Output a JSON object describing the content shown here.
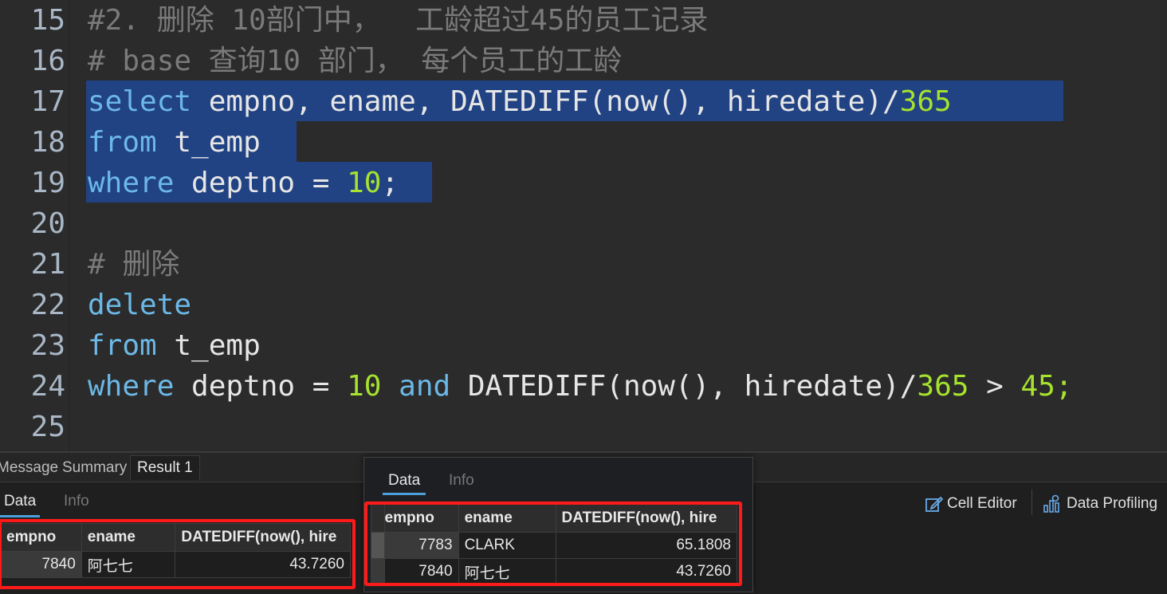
{
  "editor": {
    "lines": [
      {
        "n": "15",
        "segs": [
          {
            "t": "#2. 删除 10部门中，  工龄超过45的员工记录",
            "c": "cmt"
          }
        ]
      },
      {
        "n": "16",
        "segs": [
          {
            "t": "# base 查询10 部门， 每个员工的工龄",
            "c": "cmt"
          }
        ]
      },
      {
        "n": "17",
        "segs": [
          {
            "t": "select",
            "c": "kw"
          },
          {
            "t": " empno, ename, DATEDIFF(now(), hiredate)/",
            "c": ""
          },
          {
            "t": "365",
            "c": "num"
          },
          {
            "t": " ",
            "c": ""
          }
        ]
      },
      {
        "n": "18",
        "segs": [
          {
            "t": "from",
            "c": "kw"
          },
          {
            "t": " t_emp ",
            "c": ""
          }
        ]
      },
      {
        "n": "19",
        "segs": [
          {
            "t": "where",
            "c": "kw"
          },
          {
            "t": " deptno = ",
            "c": ""
          },
          {
            "t": "10",
            "c": "num"
          },
          {
            "t": ";",
            "c": ""
          }
        ]
      },
      {
        "n": "20",
        "segs": []
      },
      {
        "n": "21",
        "segs": [
          {
            "t": "# 删除",
            "c": "cmt"
          }
        ]
      },
      {
        "n": "22",
        "segs": [
          {
            "t": "delete",
            "c": "kw"
          }
        ]
      },
      {
        "n": "23",
        "segs": [
          {
            "t": "from",
            "c": "kw"
          },
          {
            "t": " t_emp",
            "c": ""
          }
        ]
      },
      {
        "n": "24",
        "segs": [
          {
            "t": "where",
            "c": "kw"
          },
          {
            "t": " deptno = ",
            "c": ""
          },
          {
            "t": "10",
            "c": "num"
          },
          {
            "t": " ",
            "c": ""
          },
          {
            "t": "and",
            "c": "kw"
          },
          {
            "t": " DATEDIFF(now(), hiredate)/",
            "c": ""
          },
          {
            "t": "365",
            "c": "num"
          },
          {
            "t": " > ",
            "c": ""
          },
          {
            "t": "45;",
            "c": "num"
          }
        ]
      },
      {
        "n": "25",
        "segs": []
      }
    ]
  },
  "panel": {
    "tabs": [
      "Message",
      "Summary",
      "Result 1"
    ],
    "subtabs": [
      "Data",
      "Info"
    ],
    "tools": {
      "cell_editor": "Cell Editor",
      "data_profiling": "Data Profiling"
    },
    "grid": {
      "headers": [
        "empno",
        "ename",
        "DATEDIFF(now(), hire"
      ],
      "rows": [
        [
          "7840",
          "阿七七",
          "43.7260"
        ]
      ]
    }
  },
  "overlay": {
    "subtabs": [
      "Data",
      "Info"
    ],
    "grid": {
      "headers": [
        "empno",
        "ename",
        "DATEDIFF(now(), hire"
      ],
      "rows": [
        [
          "7783",
          "CLARK",
          "65.1808"
        ],
        [
          "7840",
          "阿七七",
          "43.7260"
        ]
      ]
    }
  },
  "colors": {
    "highlight_box": "#ff1a1a",
    "selection": "#214283",
    "keyword": "#6cb8e6",
    "number": "#a6e22e"
  }
}
